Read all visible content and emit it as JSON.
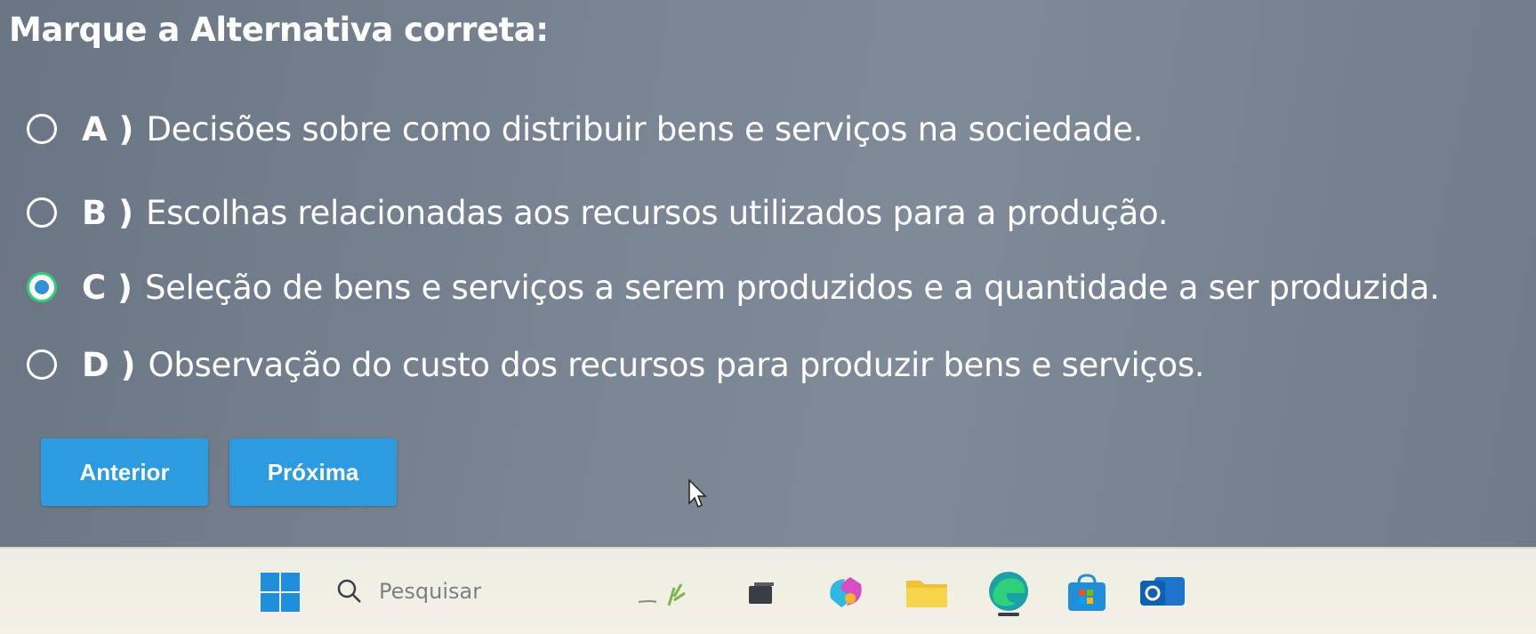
{
  "question": {
    "title": "Marque a Alternativa correta:"
  },
  "options": [
    {
      "letter": "A )",
      "text": "Decisões sobre como distribuir bens e serviços na sociedade.",
      "selected": false
    },
    {
      "letter": "B )",
      "text": "Escolhas relacionadas aos recursos utilizados para a produção.",
      "selected": false
    },
    {
      "letter": "C )",
      "text": "Seleção de bens e serviços a serem produzidos e a quantidade a ser produzida.",
      "selected": true
    },
    {
      "letter": "D )",
      "text": "Observação do custo dos recursos para produzir bens e serviços.",
      "selected": false
    }
  ],
  "navigation": {
    "previous_label": "Anterior",
    "next_label": "Próxima"
  },
  "taskbar": {
    "search_placeholder": "Pesquisar",
    "icons": [
      "windows-start-icon",
      "search-icon",
      "widgets-icon",
      "task-view-icon",
      "copilot-icon",
      "file-explorer-icon",
      "edge-browser-icon",
      "microsoft-store-icon",
      "outlook-icon"
    ]
  },
  "colors": {
    "accent": "#2d9be0",
    "selected_ring": "#2fd07a",
    "selected_dot": "#2f8fd8"
  }
}
